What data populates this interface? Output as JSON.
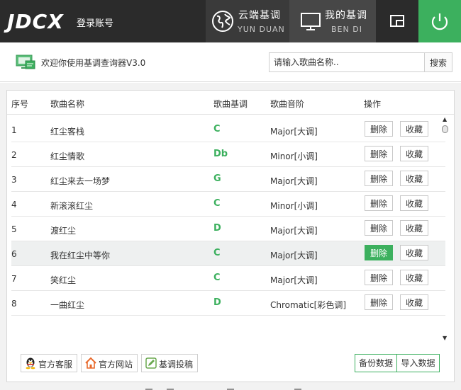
{
  "header": {
    "logo": "JDCX",
    "login": "登录账号",
    "nav_cloud": {
      "title": "云端基调",
      "sub": "YUN DUAN",
      "icon": "globe-icon"
    },
    "nav_local": {
      "title": "我的基调",
      "sub": "BEN DI",
      "icon": "monitor-icon"
    },
    "window_icon": "window-mode-icon",
    "power_icon": "power-icon"
  },
  "welcome": {
    "text": "欢迎你使用基调查询器V3.0",
    "search_placeholder": "请输入歌曲名称..",
    "search_button": "搜索"
  },
  "table": {
    "headers": {
      "index": "序号",
      "name": "歌曲名称",
      "key": "歌曲基调",
      "scale": "歌曲音阶",
      "action": "操作"
    },
    "delete_label": "删除",
    "favorite_label": "收藏",
    "rows": [
      {
        "index": "1",
        "name": "红尘客栈",
        "key": "C",
        "scale": "Major[大调]"
      },
      {
        "index": "2",
        "name": "红尘情歌",
        "key": "Db",
        "scale": "Minor[小调]"
      },
      {
        "index": "3",
        "name": "红尘来去一场梦",
        "key": "G",
        "scale": "Major[大调]"
      },
      {
        "index": "4",
        "name": "新滚滚红尘",
        "key": "C",
        "scale": "Minor[小调]"
      },
      {
        "index": "5",
        "name": "渡红尘",
        "key": "D",
        "scale": "Major[大调]"
      },
      {
        "index": "6",
        "name": "我在红尘中等你",
        "key": "C",
        "scale": "Major[大调]"
      },
      {
        "index": "7",
        "name": "笑红尘",
        "key": "C",
        "scale": "Major[大调]"
      },
      {
        "index": "8",
        "name": "一曲红尘",
        "key": "D",
        "scale": "Chromatic[彩色调]"
      }
    ],
    "highlighted_row": 6
  },
  "footer": {
    "service": "官方客服",
    "website": "官方网站",
    "submit": "基调投稿",
    "backup": "备份数据",
    "import": "导入数据"
  },
  "colors": {
    "accent": "#3cb05e",
    "header_bg": "#2b2b2b"
  }
}
